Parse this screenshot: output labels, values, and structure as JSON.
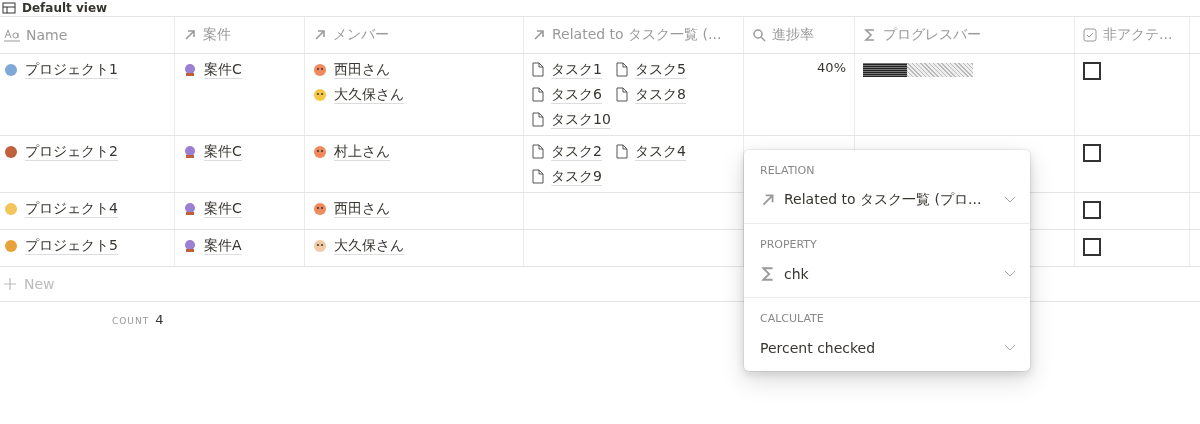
{
  "view_title": "Default view",
  "table": {
    "columns": [
      {
        "kind": "title",
        "label": "Name"
      },
      {
        "kind": "relation",
        "label": "案件"
      },
      {
        "kind": "relation",
        "label": "メンバー"
      },
      {
        "kind": "relation",
        "label": "Related to タスク一覧 (..."
      },
      {
        "kind": "lookup",
        "label": "進捗率"
      },
      {
        "kind": "rollup",
        "label": "プログレスバー"
      },
      {
        "kind": "checkbox",
        "label": "非アクテ..."
      }
    ],
    "rows": [
      {
        "name": "プロジェクト1",
        "case": "案件C",
        "members": [
          "西田さん",
          "大久保さん"
        ],
        "tasks": [
          "タスク1",
          "タスク5",
          "タスク6",
          "タスク8",
          "タスク10"
        ],
        "progress": "40%",
        "bar": {
          "level": 0.4
        },
        "inactive": {
          "checked": false
        }
      },
      {
        "name": "プロジェクト2",
        "case": "案件C",
        "members": [
          "村上さん"
        ],
        "tasks": [
          "タスク2",
          "タスク4",
          "タスク9"
        ],
        "inactive": {
          "checked": false
        }
      },
      {
        "name": "プロジェクト4",
        "case": "案件C",
        "members": [
          "西田さん"
        ],
        "tasks": [],
        "inactive": {
          "checked": false
        }
      },
      {
        "name": "プロジェクト5",
        "case": "案件A",
        "members": [
          "大久保さん"
        ],
        "tasks": [],
        "inactive": {
          "checked": false
        }
      }
    ],
    "new_row": "New",
    "footer": {
      "label": "COUNT",
      "value": "4"
    }
  },
  "rollup_menu": {
    "sections": [
      {
        "kind": "relation",
        "label": "RELATION",
        "value": "Related to タスク一覧 (プロ..."
      },
      {
        "kind": "property",
        "label": "PROPERTY",
        "value": "chk"
      },
      {
        "kind": "calculate",
        "label": "CALCULATE",
        "value": "Percent checked"
      }
    ]
  }
}
